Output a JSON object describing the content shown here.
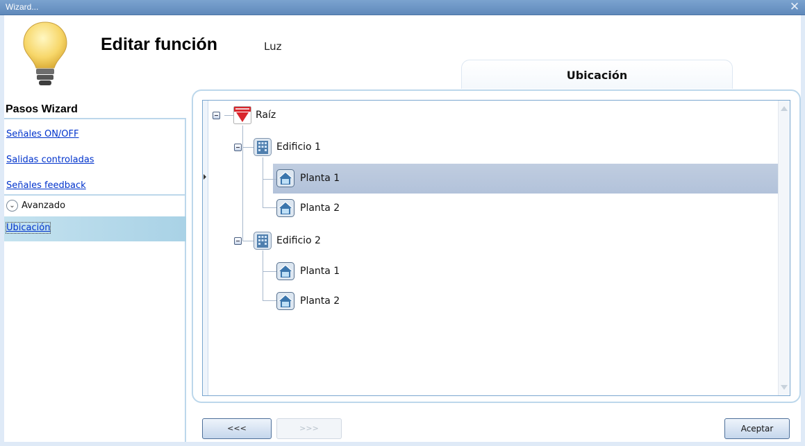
{
  "window": {
    "title": "Wizard...",
    "close_icon": "close-icon"
  },
  "header": {
    "title": "Editar función",
    "subtitle": "Luz",
    "icon": "lightbulb-icon"
  },
  "tab": {
    "label": "Ubicación"
  },
  "sidebar": {
    "title": "Pasos Wizard",
    "steps": [
      {
        "label": "Señales ON/OFF"
      },
      {
        "label": "Salidas controladas"
      },
      {
        "label": "Señales feedback"
      }
    ],
    "advanced": {
      "label": "Avanzado",
      "icon": "chevron-down-icon"
    },
    "advanced_items": [
      {
        "label": "Ubicación",
        "selected": true
      }
    ]
  },
  "tree": {
    "root": {
      "label": "Raíz",
      "icon": "carlo-gavazzi-logo-icon"
    },
    "buildings": [
      {
        "label": "Edificio 1",
        "icon": "building-icon",
        "floors": [
          {
            "label": "Planta 1",
            "selected": true
          },
          {
            "label": "Planta 2"
          }
        ]
      },
      {
        "label": "Edificio 2",
        "icon": "building-icon",
        "floors": [
          {
            "label": "Planta 1"
          },
          {
            "label": "Planta 2"
          }
        ]
      }
    ],
    "floor_icon": "floor-icon"
  },
  "buttons": {
    "prev": "<<<",
    "next": ">>>",
    "ok": "Aceptar"
  },
  "colors": {
    "selection": "#b8c7dd",
    "accent": "#bcd7eb",
    "link": "#0033cc"
  }
}
